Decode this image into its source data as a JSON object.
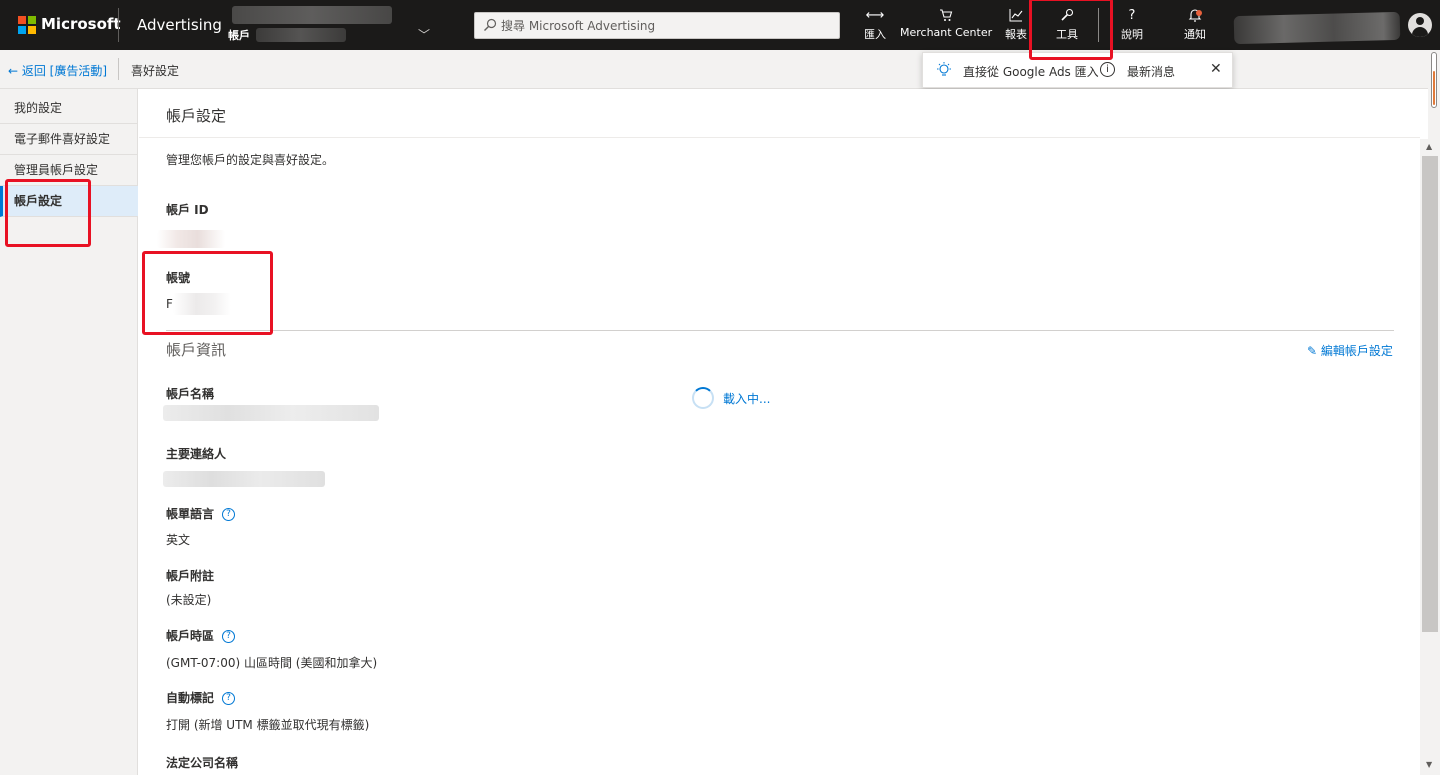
{
  "topbar": {
    "brand": "Microsoft",
    "product": "Advertising",
    "account_label": "帳戶",
    "search_placeholder": "搜尋 Microsoft Advertising",
    "nav": {
      "import": "匯入",
      "merchant_center": "Merchant Center",
      "reports": "報表",
      "tools": "工具",
      "help": "說明",
      "notifications": "通知"
    },
    "logo_colors": [
      "#f25022",
      "#7fba00",
      "#00a4ef",
      "#ffb900"
    ]
  },
  "subbar": {
    "back_link": "← 返回 [廣告活動]",
    "breadcrumb": "喜好設定"
  },
  "toast": {
    "import_text": "直接從 Google Ads 匯入",
    "info": "i",
    "news_text": "最新消息",
    "close": "✕"
  },
  "leftnav": {
    "items": [
      {
        "label": "我的設定"
      },
      {
        "label": "電子郵件喜好設定"
      },
      {
        "label": "管理員帳戶設定"
      },
      {
        "label": "帳戶設定"
      }
    ]
  },
  "main": {
    "title": "帳戶設定",
    "description": "管理您帳戶的設定與喜好設定。",
    "account_id_label": "帳戶 ID",
    "account_number_label": "帳號",
    "account_number_value": "F",
    "section_title": "帳戶資訊",
    "edit_link": "✎ 編輯帳戶設定",
    "loading": "載入中...",
    "fields": {
      "account_name": "帳戶名稱",
      "primary_contact": "主要連絡人",
      "billing_language": "帳單語言",
      "billing_language_value": "英文",
      "account_notes": "帳戶附註",
      "account_notes_value": "(未設定)",
      "time_zone": "帳戶時區",
      "time_zone_value": "(GMT-07:00) 山區時間 (美國和加拿大)",
      "auto_tagging": "自動標記",
      "auto_tagging_value": "打開 (新增 UTM 標籤並取代現有標籤)",
      "legal_company": "法定公司名稱"
    },
    "help_glyph": "?"
  },
  "colors": {
    "accent": "#0078d4",
    "topbar_bg": "#1b1a19",
    "annotation_red": "#e81123"
  }
}
